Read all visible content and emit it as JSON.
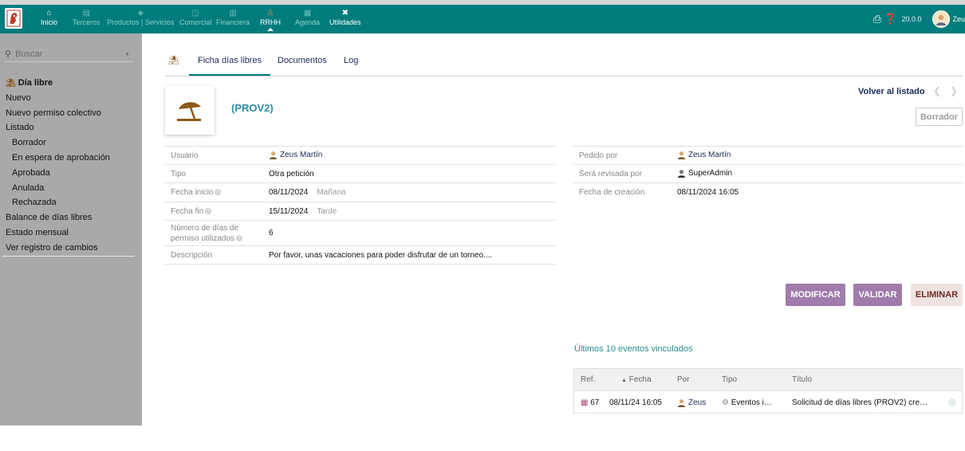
{
  "topbar": {
    "menu": [
      {
        "label": "Inicio",
        "icon": "home-icon",
        "glyph": "⌂"
      },
      {
        "label": "Terceros",
        "icon": "building-icon",
        "glyph": "▤"
      },
      {
        "label": "Productos | Servicios",
        "icon": "cube-icon",
        "glyph": "◈"
      },
      {
        "label": "Comercial",
        "icon": "briefcase-icon",
        "glyph": "◫"
      },
      {
        "label": "Financiera",
        "icon": "bank-icon",
        "glyph": "▥"
      },
      {
        "label": "RRHH",
        "icon": "person-icon",
        "glyph": "♙"
      },
      {
        "label": "Agenda",
        "icon": "calendar-icon",
        "glyph": "▦"
      },
      {
        "label": "Utilidades",
        "icon": "tools-icon",
        "glyph": "✖"
      }
    ],
    "version": "20.0.0",
    "user_short": "Zeu",
    "colors": {
      "bar": "#017c7c",
      "sidebar": "#a9a9a9",
      "accent": "#017c7c",
      "button": "#a07bac",
      "danger_bg": "#efe3df"
    }
  },
  "sidebar": {
    "search_placeholder": "Buscar",
    "title": "Día libre",
    "items": [
      "Nuevo",
      "Nuevo permiso colectivo",
      "Listado",
      "Borrador",
      "En espera de aprobación",
      "Aprobada",
      "Anulada",
      "Rechazada",
      "Balance de días libres",
      "Estado mensual",
      "Ver registro de cambios"
    ]
  },
  "tabs": {
    "items": [
      "Ficha días libres",
      "Documentos",
      "Log"
    ],
    "active": "Ficha días libres"
  },
  "record": {
    "ref": "(PROV2)",
    "back_label": "Volver al listado",
    "status": "Borrador"
  },
  "fields_left": {
    "usuario_label": "Usuario",
    "usuario_value": "Zeus Martín",
    "tipo_label": "Tipo",
    "tipo_value": "Otra petición",
    "fecha_inicio_label": "Fecha inicio",
    "fecha_inicio_value": "08/11/2024",
    "fecha_inicio_half": "Mañana",
    "fecha_fin_label": "Fecha fin",
    "fecha_fin_value": "15/11/2024",
    "fecha_fin_half": "Tarde",
    "dias_label_1": "Número de días de",
    "dias_label_2": "permiso utilizados",
    "dias_value": "6",
    "descripcion_label": "Descripción",
    "descripcion_value": "Por favor, unas vacaciones para poder disfrutar de un torneo...."
  },
  "fields_right": {
    "pedido_label": "Pedido por",
    "pedido_value": "Zeus Martín",
    "revisada_label": "Será revisada por",
    "revisada_value": "SuperAdmin",
    "creacion_label": "Fecha de creación",
    "creacion_value": "08/11/2024 16:05"
  },
  "actions": {
    "modify": "MODIFICAR",
    "validate": "VALIDAR",
    "delete": "ELIMINAR"
  },
  "events": {
    "title": "Últimos 10 eventos vinculados",
    "headers": [
      "Ref.",
      "Fecha",
      "Por",
      "Tipo",
      "Título"
    ],
    "rows": [
      {
        "ref": "67",
        "date": "08/11/24 16:05",
        "by": "Zeus",
        "type": "Eventos i…",
        "title": "Solicitud de días libres (PROV2) cre…"
      }
    ]
  }
}
